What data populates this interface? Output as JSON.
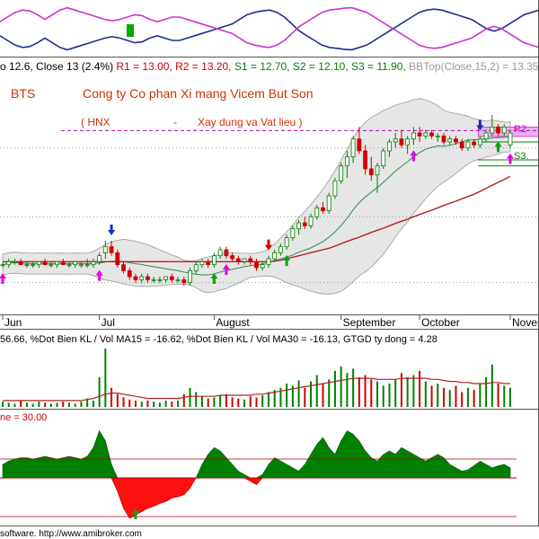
{
  "colors": {
    "bull": "#008000",
    "bear": "#d00000",
    "ma_fast": "#2e8b57",
    "ma_slow": "#b22222",
    "band_fill": "#e6e6e6",
    "band_line": "#9a9a9a",
    "pivot": "#c000c0",
    "osc_blue": "#1f2f8f",
    "osc_magenta": "#cc33cc",
    "title_color": "#cc3300",
    "info_gray": "#999999"
  },
  "header": {
    "stats_prefix": "o 12.6, Close 13 (2.4%)",
    "r1_label": " R1 = 13.00,",
    "r2_label": " R2 = 13.20,",
    "s1_label": " S1 = 12.70,",
    "s2_label": " S2 = 12.10,",
    "s3_label": " S3 = 11.90,",
    "bbtop_label": " BBTop(Close,15,2) = 13.35"
  },
  "chart_title": {
    "ticker": "BTS",
    "company": "Cong ty Co phan Xi mang Vicem But Son",
    "exchange": "( HNX",
    "dash": "-",
    "sector": "Xay dung va Vat lieu )"
  },
  "level_labels": {
    "r2": "R2",
    "s3": "S3."
  },
  "volume_header": "56.66, %Dot Bien KL / Vol MA15  = -16.62, %Dot Bien KL / Vol MA30  = -16.13, GTGD ty dong = 4.28",
  "money_flow_header": "ne = 30.00",
  "footer": "software. http://www.amibroker.com",
  "chart_data": [
    {
      "type": "line",
      "panel": "oscillator",
      "series": [
        {
          "values": [
            0.35,
            0.25,
            0.15,
            0.1,
            0.12,
            0.2,
            0.3,
            0.2,
            0.1,
            0.05,
            0.1,
            0.15,
            0.2,
            0.25,
            0.3,
            0.33,
            0.3,
            0.25,
            0.2,
            0.22,
            0.3,
            0.35,
            0.3,
            0.25,
            0.25,
            0.3,
            0.35,
            0.4,
            0.45,
            0.5,
            0.55,
            0.6,
            0.7,
            0.8,
            0.85,
            0.88,
            0.9,
            0.85,
            0.75,
            0.6,
            0.45,
            0.35,
            0.25,
            0.15,
            0.1,
            0.08,
            0.06,
            0.05,
            0.1,
            0.15,
            0.25,
            0.35,
            0.45,
            0.55,
            0.65,
            0.75,
            0.85,
            0.9,
            0.92,
            0.9,
            0.85,
            0.8,
            0.75,
            0.7,
            0.6,
            0.5,
            0.45,
            0.5,
            0.6,
            0.7,
            0.8,
            0.85,
            0.9
          ]
        },
        {
          "values": [
            0.65,
            0.75,
            0.85,
            0.9,
            0.88,
            0.8,
            0.7,
            0.8,
            0.9,
            0.95,
            0.9,
            0.85,
            0.8,
            0.75,
            0.7,
            0.67,
            0.7,
            0.75,
            0.8,
            0.78,
            0.7,
            0.65,
            0.7,
            0.75,
            0.75,
            0.7,
            0.65,
            0.6,
            0.55,
            0.5,
            0.45,
            0.4,
            0.3,
            0.2,
            0.15,
            0.12,
            0.1,
            0.15,
            0.25,
            0.4,
            0.55,
            0.65,
            0.75,
            0.85,
            0.9,
            0.92,
            0.94,
            0.95,
            0.9,
            0.85,
            0.75,
            0.65,
            0.55,
            0.45,
            0.35,
            0.25,
            0.15,
            0.1,
            0.08,
            0.1,
            0.15,
            0.2,
            0.25,
            0.3,
            0.4,
            0.5,
            0.55,
            0.5,
            0.4,
            0.3,
            0.2,
            0.15,
            0.1
          ]
        }
      ]
    },
    {
      "type": "candlestick",
      "panel": "price",
      "x_tick_labels": [
        "Jun",
        "Jul",
        "August",
        "September",
        "October",
        "November"
      ],
      "candles": [
        [
          8.6,
          8.7,
          8.5,
          8.6
        ],
        [
          8.6,
          8.8,
          8.5,
          8.7
        ],
        [
          8.7,
          8.8,
          8.6,
          8.7
        ],
        [
          8.7,
          8.8,
          8.6,
          8.6
        ],
        [
          8.6,
          8.7,
          8.5,
          8.6
        ],
        [
          8.6,
          8.7,
          8.5,
          8.6
        ],
        [
          8.6,
          8.7,
          8.5,
          8.7
        ],
        [
          8.7,
          8.8,
          8.6,
          8.6
        ],
        [
          8.6,
          8.7,
          8.5,
          8.6
        ],
        [
          8.6,
          8.7,
          8.5,
          8.7
        ],
        [
          8.7,
          8.8,
          8.6,
          8.6
        ],
        [
          8.6,
          8.7,
          8.5,
          8.6
        ],
        [
          8.6,
          8.7,
          8.5,
          8.7
        ],
        [
          8.6,
          8.7,
          8.5,
          8.6
        ],
        [
          8.6,
          8.8,
          8.5,
          8.6
        ],
        [
          8.6,
          8.8,
          8.5,
          8.7
        ],
        [
          8.7,
          9.0,
          8.6,
          8.9
        ],
        [
          9.0,
          9.4,
          8.8,
          9.2
        ],
        [
          9.2,
          9.4,
          8.9,
          9.0
        ],
        [
          9.0,
          9.1,
          8.5,
          8.6
        ],
        [
          8.6,
          8.7,
          8.3,
          8.4
        ],
        [
          8.4,
          8.5,
          8.1,
          8.2
        ],
        [
          8.2,
          8.3,
          8.0,
          8.1
        ],
        [
          8.1,
          8.3,
          8.0,
          8.2
        ],
        [
          8.2,
          8.3,
          8.0,
          8.1
        ],
        [
          8.1,
          8.2,
          8.0,
          8.1
        ],
        [
          8.1,
          8.2,
          8.0,
          8.1
        ],
        [
          8.1,
          8.2,
          8.0,
          8.2
        ],
        [
          8.2,
          8.3,
          8.0,
          8.1
        ],
        [
          8.1,
          8.2,
          8.0,
          8.1
        ],
        [
          8.1,
          8.2,
          7.9,
          8.0
        ],
        [
          8.0,
          8.5,
          7.9,
          8.4
        ],
        [
          8.4,
          8.7,
          8.3,
          8.6
        ],
        [
          8.6,
          8.8,
          8.5,
          8.7
        ],
        [
          8.7,
          8.8,
          8.5,
          8.6
        ],
        [
          8.6,
          9.0,
          8.5,
          8.9
        ],
        [
          8.9,
          9.2,
          8.8,
          9.1
        ],
        [
          9.1,
          9.2,
          8.8,
          8.9
        ],
        [
          8.9,
          9.0,
          8.7,
          8.8
        ],
        [
          8.8,
          8.9,
          8.6,
          8.7
        ],
        [
          8.7,
          8.8,
          8.6,
          8.8
        ],
        [
          8.8,
          8.9,
          8.6,
          8.7
        ],
        [
          8.7,
          8.8,
          8.4,
          8.5
        ],
        [
          8.5,
          8.7,
          8.4,
          8.6
        ],
        [
          8.6,
          8.9,
          8.5,
          8.8
        ],
        [
          8.8,
          9.1,
          8.7,
          9.0
        ],
        [
          9.0,
          9.3,
          8.9,
          9.2
        ],
        [
          9.2,
          9.6,
          9.1,
          9.5
        ],
        [
          9.5,
          9.9,
          9.4,
          9.8
        ],
        [
          9.8,
          10.1,
          9.6,
          10.0
        ],
        [
          10.0,
          10.2,
          9.8,
          9.9
        ],
        [
          9.9,
          10.3,
          9.8,
          10.2
        ],
        [
          10.2,
          10.6,
          10.1,
          10.5
        ],
        [
          10.5,
          10.7,
          10.3,
          10.4
        ],
        [
          10.4,
          11.0,
          10.3,
          10.9
        ],
        [
          10.9,
          11.5,
          10.8,
          11.4
        ],
        [
          11.4,
          12.0,
          11.3,
          11.9
        ],
        [
          11.9,
          12.4,
          11.5,
          12.2
        ],
        [
          12.2,
          12.9,
          12.0,
          12.8
        ],
        [
          12.8,
          13.2,
          12.3,
          12.4
        ],
        [
          12.4,
          12.6,
          11.6,
          11.8
        ],
        [
          11.8,
          12.2,
          11.4,
          11.6
        ],
        [
          11.6,
          12.0,
          11.0,
          11.9
        ],
        [
          11.9,
          12.5,
          11.8,
          12.4
        ],
        [
          12.4,
          12.8,
          12.2,
          12.7
        ],
        [
          12.7,
          13.0,
          12.5,
          12.8
        ],
        [
          12.8,
          13.1,
          12.5,
          12.6
        ],
        [
          12.6,
          12.9,
          12.3,
          12.8
        ],
        [
          12.8,
          13.2,
          12.6,
          13.0
        ],
        [
          13.0,
          13.2,
          12.7,
          12.9
        ],
        [
          12.9,
          13.1,
          12.8,
          13.0
        ],
        [
          13.0,
          13.1,
          12.8,
          12.9
        ],
        [
          12.9,
          13.0,
          12.7,
          12.9
        ],
        [
          12.9,
          13.0,
          12.6,
          12.7
        ],
        [
          12.7,
          12.9,
          12.6,
          12.8
        ],
        [
          12.8,
          12.9,
          12.6,
          12.7
        ],
        [
          12.7,
          12.8,
          12.4,
          12.5
        ],
        [
          12.5,
          12.8,
          12.4,
          12.7
        ],
        [
          12.7,
          12.8,
          12.5,
          12.6
        ],
        [
          12.6,
          12.9,
          12.5,
          12.8
        ],
        [
          12.8,
          13.1,
          12.7,
          13.0
        ],
        [
          13.0,
          13.6,
          12.9,
          13.2
        ],
        [
          13.2,
          13.3,
          12.9,
          13.0
        ],
        [
          13.0,
          13.3,
          12.9,
          13.2
        ],
        [
          12.6,
          13.1,
          12.5,
          13.0
        ]
      ],
      "band_width": [
        0.35,
        0.35,
        0.35,
        0.35,
        0.35,
        0.35,
        0.35,
        0.35,
        0.35,
        0.35,
        0.35,
        0.35,
        0.35,
        0.35,
        0.35,
        0.4,
        0.5,
        0.6,
        0.65,
        0.7,
        0.75,
        0.75,
        0.75,
        0.72,
        0.7,
        0.65,
        0.6,
        0.55,
        0.5,
        0.45,
        0.4,
        0.4,
        0.45,
        0.55,
        0.6,
        0.6,
        0.6,
        0.6,
        0.55,
        0.5,
        0.45,
        0.4,
        0.4,
        0.4,
        0.45,
        0.55,
        0.7,
        0.85,
        1.0,
        1.15,
        1.3,
        1.45,
        1.6,
        1.75,
        1.9,
        2.05,
        2.2,
        2.3,
        2.4,
        2.45,
        2.5,
        2.5,
        2.45,
        2.4,
        2.3,
        2.2,
        2.1,
        2.0,
        1.9,
        1.8,
        1.65,
        1.5,
        1.35,
        1.2,
        1.1,
        1.0,
        0.9,
        0.8,
        0.7,
        0.65,
        0.6,
        0.6,
        0.55,
        0.5,
        0.5
      ],
      "ma_slow": [
        8.7,
        8.7,
        8.7,
        8.7,
        8.7,
        8.7,
        8.7,
        8.7,
        8.7,
        8.7,
        8.7,
        8.7,
        8.7,
        8.7,
        8.7,
        8.7,
        8.7,
        8.7,
        8.7,
        8.7,
        8.7,
        8.7,
        8.7,
        8.7,
        8.7,
        8.7,
        8.7,
        8.7,
        8.7,
        8.7,
        8.7,
        8.7,
        8.7,
        8.7,
        8.7,
        8.7,
        8.7,
        8.7,
        8.7,
        8.7,
        8.7,
        8.7,
        8.7,
        8.7,
        8.7,
        8.72,
        8.75,
        8.8,
        8.85,
        8.9,
        8.95,
        9.0,
        9.05,
        9.1,
        9.15,
        9.22,
        9.3,
        9.38,
        9.45,
        9.52,
        9.6,
        9.68,
        9.75,
        9.82,
        9.9,
        9.98,
        10.05,
        10.12,
        10.2,
        10.28,
        10.35,
        10.42,
        10.5,
        10.58,
        10.65,
        10.72,
        10.8,
        10.88,
        10.95,
        11.05,
        11.15,
        11.25,
        11.35,
        11.45,
        11.55
      ],
      "pivot_band": {
        "r1": 13.0,
        "r2": 13.2,
        "s1": 12.7,
        "s2": 12.1,
        "s3": 11.9
      },
      "signals": [
        {
          "i": 0,
          "kind": "up",
          "color": "magenta"
        },
        {
          "i": 16,
          "kind": "up",
          "color": "magenta"
        },
        {
          "i": 18,
          "kind": "down",
          "color": "blue"
        },
        {
          "i": 35,
          "kind": "up",
          "color": "green"
        },
        {
          "i": 37,
          "kind": "up",
          "color": "magenta"
        },
        {
          "i": 44,
          "kind": "down",
          "color": "red"
        },
        {
          "i": 47,
          "kind": "up",
          "color": "green"
        },
        {
          "i": 68,
          "kind": "up",
          "color": "magenta"
        },
        {
          "i": 79,
          "kind": "down",
          "color": "blue"
        },
        {
          "i": 82,
          "kind": "up",
          "color": "green"
        },
        {
          "i": 84,
          "kind": "up",
          "color": "magenta"
        }
      ]
    },
    {
      "type": "bar",
      "panel": "volume",
      "values": [
        5,
        4,
        3,
        6,
        4,
        3,
        5,
        4,
        3,
        4,
        5,
        4,
        3,
        5,
        8,
        6,
        28,
        55,
        18,
        12,
        9,
        7,
        6,
        5,
        6,
        5,
        4,
        6,
        5,
        6,
        12,
        18,
        14,
        10,
        8,
        9,
        11,
        12,
        9,
        8,
        7,
        10,
        9,
        11,
        14,
        16,
        18,
        22,
        20,
        25,
        18,
        24,
        30,
        22,
        26,
        34,
        38,
        32,
        36,
        28,
        30,
        26,
        24,
        20,
        22,
        26,
        32,
        28,
        30,
        34,
        24,
        20,
        22,
        18,
        16,
        20,
        14,
        18,
        16,
        22,
        28,
        40,
        22,
        20,
        18
      ],
      "ma": [
        6,
        6,
        6,
        6,
        6,
        6,
        6,
        6,
        6,
        6,
        6,
        6,
        6,
        6,
        7,
        8,
        10,
        12,
        13,
        13,
        12,
        11,
        10,
        9,
        8,
        8,
        8,
        8,
        8,
        8,
        9,
        10,
        10,
        10,
        10,
        10,
        11,
        11,
        11,
        11,
        11,
        11,
        12,
        12,
        13,
        14,
        15,
        16,
        17,
        18,
        19,
        20,
        21,
        22,
        23,
        24,
        25,
        26,
        27,
        27,
        27,
        27,
        26,
        26,
        26,
        26,
        27,
        27,
        27,
        27,
        27,
        26,
        26,
        25,
        24,
        24,
        23,
        23,
        22,
        22,
        22,
        23,
        23,
        22,
        22
      ],
      "bar_colors": "up_green_down_red"
    },
    {
      "type": "area",
      "panel": "money_flow",
      "values": [
        0.2,
        0.25,
        0.28,
        0.3,
        0.3,
        0.28,
        0.3,
        0.32,
        0.3,
        0.28,
        0.3,
        0.32,
        0.3,
        0.28,
        0.32,
        0.45,
        0.7,
        0.55,
        0.2,
        -0.2,
        -0.45,
        -0.6,
        -0.55,
        -0.5,
        -0.45,
        -0.42,
        -0.38,
        -0.35,
        -0.3,
        -0.28,
        -0.25,
        -0.15,
        0.0,
        0.2,
        0.35,
        0.45,
        0.4,
        0.3,
        0.2,
        0.1,
        0.05,
        -0.05,
        -0.1,
        0.05,
        0.2,
        0.3,
        0.25,
        0.2,
        0.15,
        0.1,
        0.2,
        0.35,
        0.5,
        0.6,
        0.45,
        0.35,
        0.55,
        0.7,
        0.65,
        0.55,
        0.4,
        0.3,
        0.25,
        0.35,
        0.4,
        0.35,
        0.45,
        0.4,
        0.35,
        0.3,
        0.25,
        0.3,
        0.35,
        0.3,
        0.2,
        0.15,
        0.1,
        0.12,
        0.18,
        0.25,
        0.2,
        0.15,
        0.18,
        0.2,
        0.15
      ],
      "threshold": 30.0
    }
  ]
}
